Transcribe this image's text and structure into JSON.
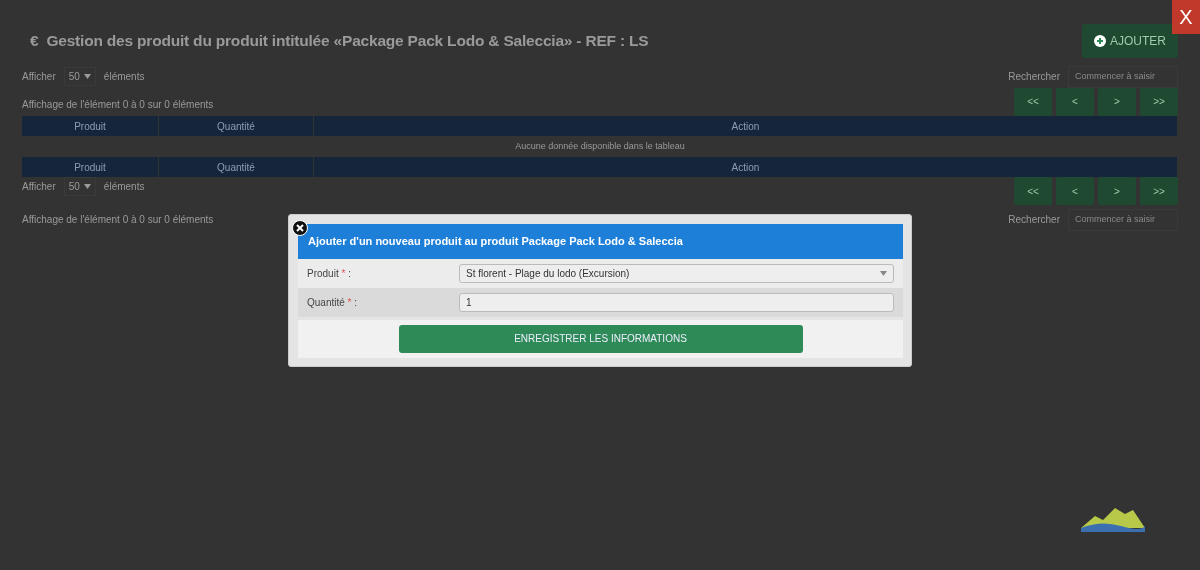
{
  "page": {
    "title_icon": "€",
    "title": "Gestion des produit du produit intitulée «Package Pack Lodo & Saleccia» - REF : LS",
    "add_button": "AJOUTER",
    "close_button": "X"
  },
  "top_controls": {
    "length_before": "Afficher",
    "length_value": "50",
    "length_after": "éléments",
    "search_label": "Rechercher",
    "search_placeholder": "Commencer à saisir",
    "info": "Affichage de l'élément 0 à 0 sur 0 éléments",
    "pagination": [
      "<<",
      "<",
      ">",
      ">>"
    ]
  },
  "table": {
    "columns": [
      "Produit",
      "Quantité",
      "Action"
    ],
    "empty_message": "Aucune donnée disponible dans le tableau",
    "footer_columns": [
      "Produit",
      "Quantité",
      "Action"
    ]
  },
  "bottom_controls": {
    "length_before": "Afficher",
    "length_value": "50",
    "length_after": "éléments",
    "search_label": "Rechercher",
    "search_placeholder": "Commencer à saisir",
    "info": "Affichage de l'élément 0 à 0 sur 0 éléments",
    "pagination": [
      "<<",
      "<",
      ">",
      ">>"
    ]
  },
  "modal": {
    "title": "Ajouter d'un nouveau produit au produit Package Pack Lodo & Saleccia",
    "fields": [
      {
        "kind": "select",
        "label": "Produit",
        "mark": "*",
        "suffix": ":",
        "value": "St florent - Plage du lodo (Excursion)"
      },
      {
        "kind": "input",
        "label": "Quantité",
        "mark": "*",
        "suffix": ":",
        "value": "1"
      }
    ],
    "submit": "ENREGISTRER LES INFORMATIONS"
  }
}
